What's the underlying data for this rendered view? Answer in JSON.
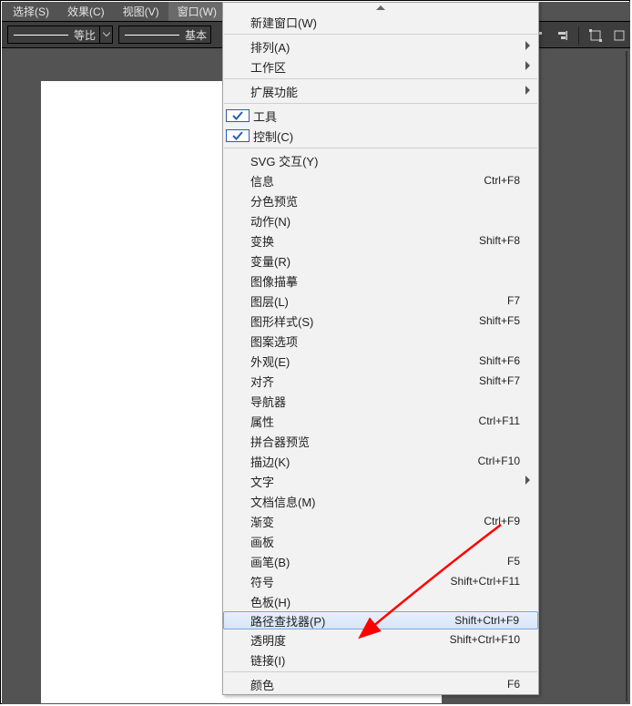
{
  "menubar": {
    "items": [
      {
        "label": "选择(S)"
      },
      {
        "label": "效果(C)"
      },
      {
        "label": "视图(V)"
      },
      {
        "label": "窗口(W)"
      }
    ],
    "active_index": 3
  },
  "toolbar": {
    "combo1": "等比",
    "combo2": "基本"
  },
  "menu": {
    "groups": [
      [
        {
          "label": "新建窗口(W)"
        }
      ],
      [
        {
          "label": "排列(A)",
          "submenu": true
        },
        {
          "label": "工作区",
          "submenu": true
        }
      ],
      [
        {
          "label": "扩展功能",
          "submenu": true
        }
      ],
      [
        {
          "label": "工具",
          "checked": true
        },
        {
          "label": "控制(C)",
          "checked": true
        }
      ],
      [
        {
          "label": "SVG 交互(Y)"
        },
        {
          "label": "信息",
          "shortcut": "Ctrl+F8"
        },
        {
          "label": "分色预览"
        },
        {
          "label": "动作(N)"
        },
        {
          "label": "变换",
          "shortcut": "Shift+F8"
        },
        {
          "label": "变量(R)"
        },
        {
          "label": "图像描摹"
        },
        {
          "label": "图层(L)",
          "shortcut": "F7"
        },
        {
          "label": "图形样式(S)",
          "shortcut": "Shift+F5"
        },
        {
          "label": "图案选项"
        },
        {
          "label": "外观(E)",
          "shortcut": "Shift+F6"
        },
        {
          "label": "对齐",
          "shortcut": "Shift+F7"
        },
        {
          "label": "导航器"
        },
        {
          "label": "属性",
          "shortcut": "Ctrl+F11"
        },
        {
          "label": "拼合器预览"
        },
        {
          "label": "描边(K)",
          "shortcut": "Ctrl+F10"
        },
        {
          "label": "文字",
          "submenu": true
        },
        {
          "label": "文档信息(M)"
        },
        {
          "label": "渐变",
          "shortcut": "Ctrl+F9"
        },
        {
          "label": "画板"
        },
        {
          "label": "画笔(B)",
          "shortcut": "F5"
        },
        {
          "label": "符号",
          "shortcut": "Shift+Ctrl+F11"
        },
        {
          "label": "色板(H)"
        },
        {
          "label": "路径查找器(P)",
          "shortcut": "Shift+Ctrl+F9",
          "highlight": true
        },
        {
          "label": "透明度",
          "shortcut": "Shift+Ctrl+F10"
        },
        {
          "label": "链接(I)"
        }
      ],
      [
        {
          "label": "颜色",
          "shortcut": "F6"
        }
      ]
    ]
  }
}
